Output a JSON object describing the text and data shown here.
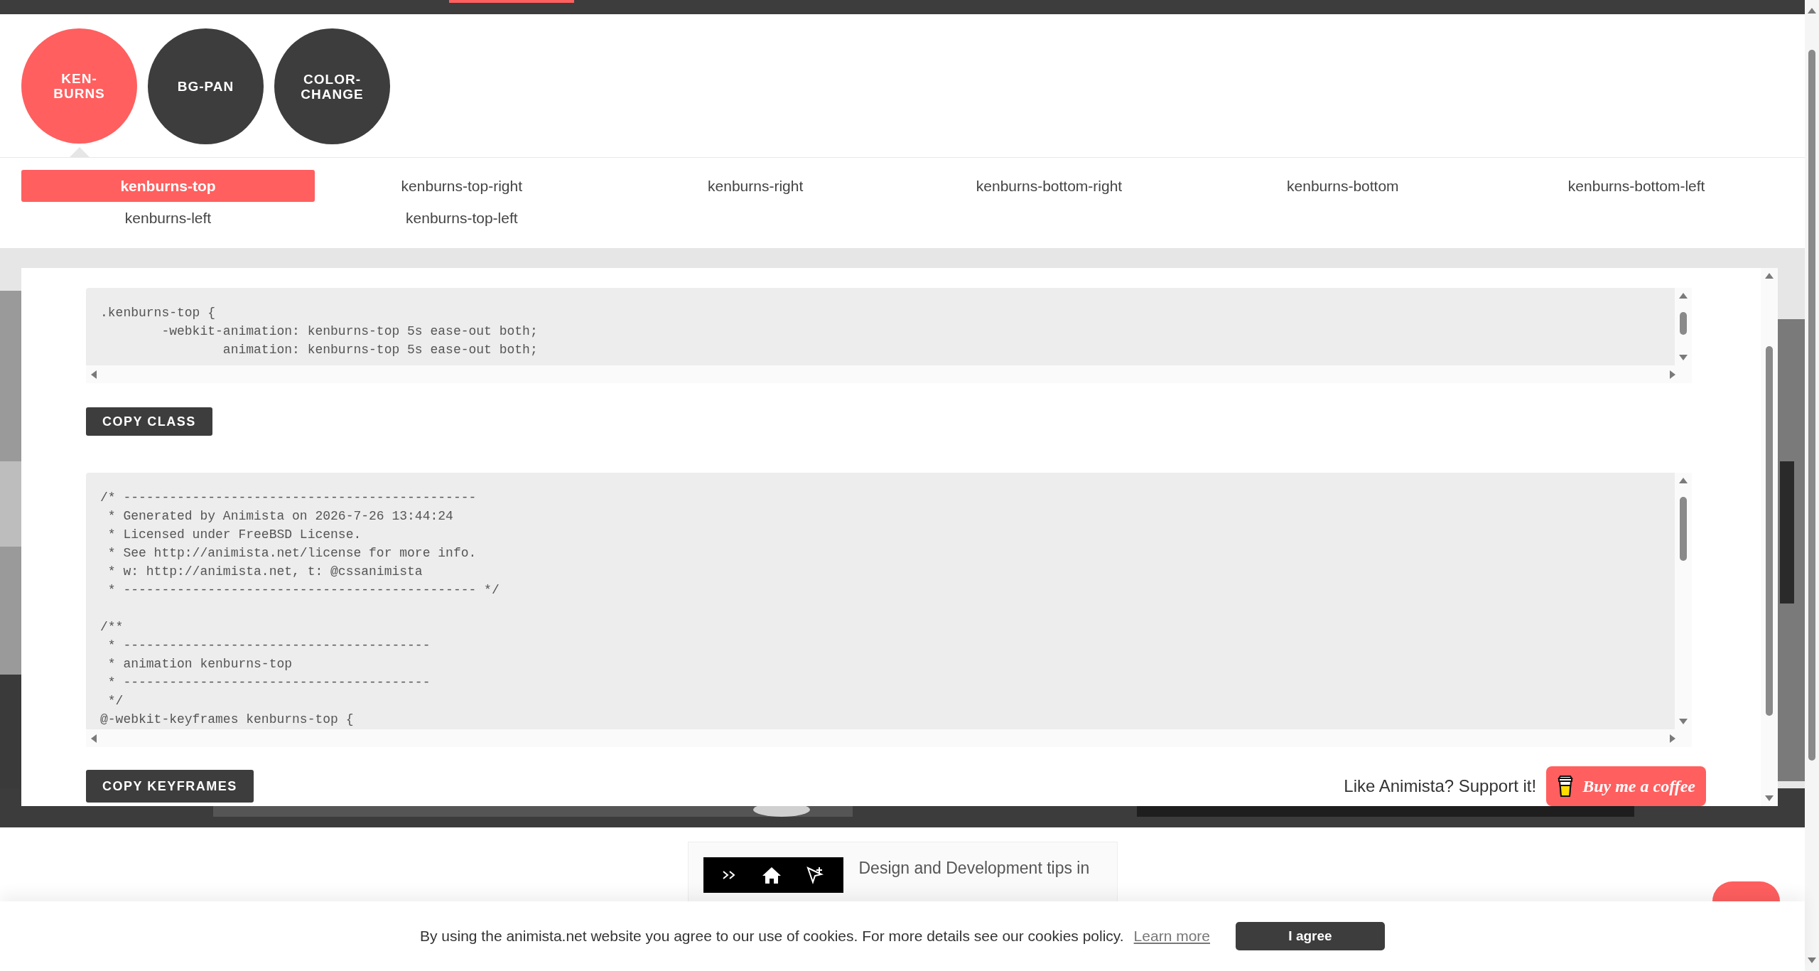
{
  "categories": [
    {
      "label": "KEN-BURNS",
      "selected": true
    },
    {
      "label": "BG-PAN",
      "selected": false
    },
    {
      "label": "COLOR-CHANGE",
      "selected": false
    }
  ],
  "animations": [
    {
      "label": "kenburns-top",
      "selected": true
    },
    {
      "label": "kenburns-top-right",
      "selected": false
    },
    {
      "label": "kenburns-right",
      "selected": false
    },
    {
      "label": "kenburns-bottom-right",
      "selected": false
    },
    {
      "label": "kenburns-bottom",
      "selected": false
    },
    {
      "label": "kenburns-bottom-left",
      "selected": false
    },
    {
      "label": "kenburns-left",
      "selected": false
    },
    {
      "label": "kenburns-top-left",
      "selected": false
    }
  ],
  "class_code": {
    "lines": [
      ".kenburns-top {",
      "        -webkit-animation: kenburns-top 5s ease-out both;",
      "                animation: kenburns-top 5s ease-out both;"
    ]
  },
  "copy_class_button": "COPY CLASS",
  "keyframes_code": {
    "blocks": [
      [
        "/* ----------------------------------------------",
        " * Generated by Animista on 2026-7-26 13:44:24",
        " * Licensed under FreeBSD License.",
        " * See http://animista.net/license for more info.",
        " * w: http://animista.net, t: @cssanimista",
        " * ---------------------------------------------- */"
      ],
      [
        "/**",
        " * ----------------------------------------",
        " * animation kenburns-top",
        " * ----------------------------------------",
        " */",
        "@-webkit-keyframes kenburns-top {"
      ]
    ]
  },
  "copy_keyframes_button": "COPY KEYFRAMES",
  "support": {
    "text": "Like Animista? Support it!",
    "button": "Buy me a coffee"
  },
  "newsletter": {
    "text": "Design and Development tips in"
  },
  "cookie_banner": {
    "text": "By using the animista.net website you agree to our use of cookies. For more details see our cookies policy.",
    "link": "Learn more",
    "button": "I agree"
  }
}
